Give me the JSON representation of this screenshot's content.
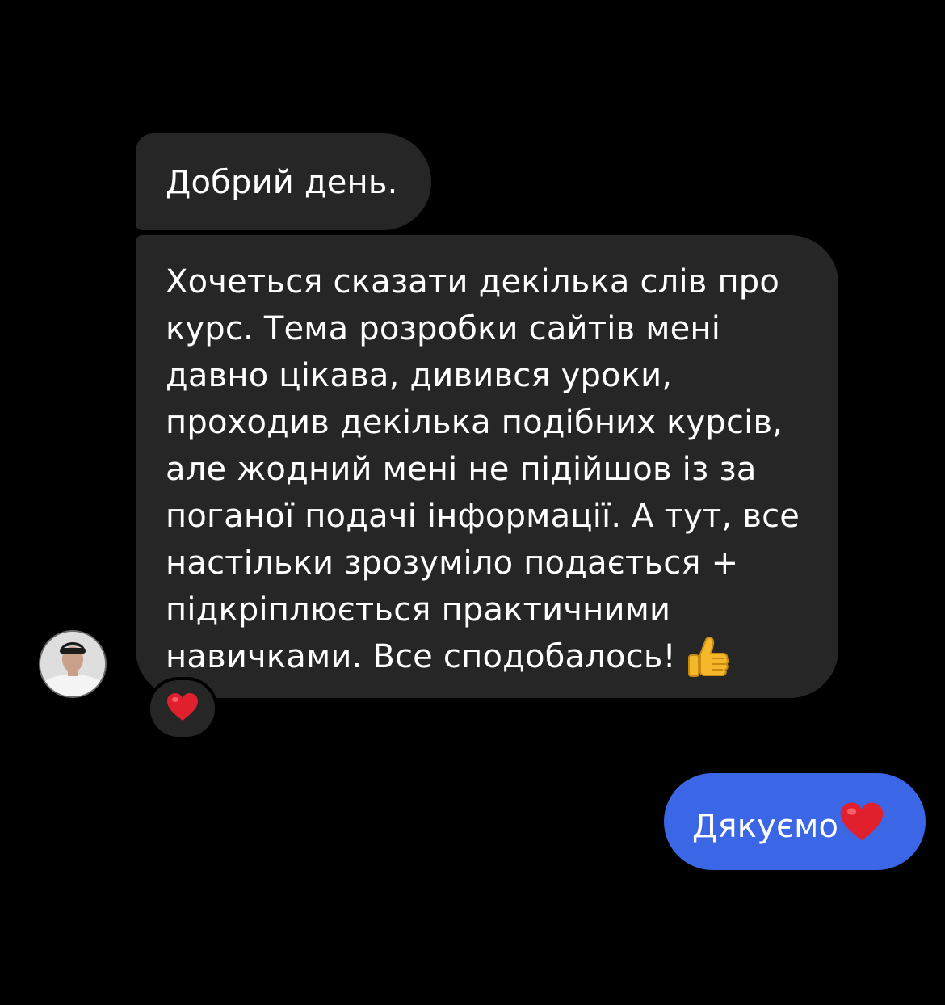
{
  "conversation": {
    "incoming": [
      {
        "lines": [
          "Добрий день."
        ]
      },
      {
        "lines": [
          "Хочеться сказати декілька слів про",
          "курс. Тема розробки сайтів мені",
          "давно цікава, дивився уроки,",
          "проходив декілька подібних курсів,",
          "але жодний мені не підійшов із за",
          "поганої подачі інформації. А тут, все",
          "настільки зрозуміло подається +",
          "підкріплюється практичними",
          "навичками. Все сподобалось!"
        ],
        "trailing_emoji": "thumbs-up-icon",
        "reaction": "heart-icon"
      }
    ],
    "outgoing": [
      {
        "text": "Дякуємо",
        "trailing_emoji": "heart-icon"
      }
    ]
  },
  "colors": {
    "background": "#000000",
    "incoming_bubble": "#262626",
    "outgoing_bubble": "#3b66e6",
    "text": "#ffffff",
    "heart": "#e0202c",
    "thumb": "#f5b82a"
  }
}
